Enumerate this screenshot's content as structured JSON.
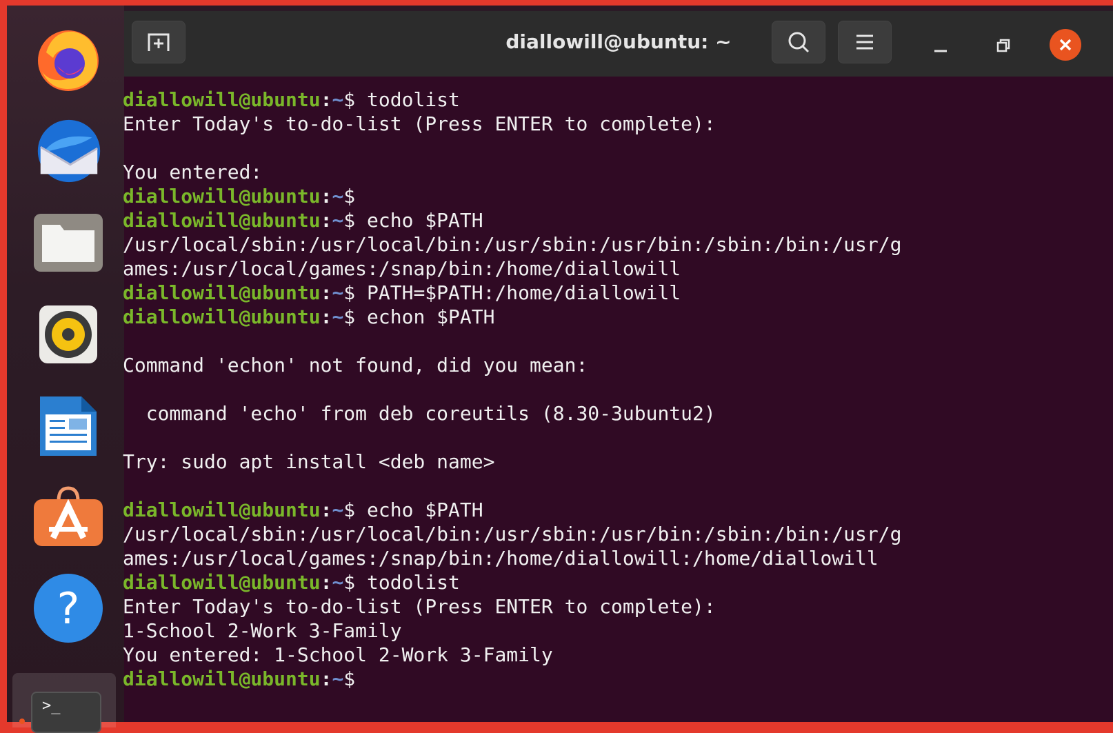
{
  "window": {
    "title": "diallowill@ubuntu: ~"
  },
  "dock": {
    "items": [
      "Firefox",
      "Thunderbird",
      "Files",
      "Rhythmbox",
      "LibreOffice Impress",
      "Ubuntu Software",
      "Help",
      "Terminal"
    ],
    "terminal_glyph": ">_"
  },
  "prompt": {
    "user": "diallowill@ubuntu",
    "sep": ":",
    "path": "~",
    "dollar": "$"
  },
  "terminal": {
    "lines": [
      {
        "type": "prompt",
        "cmd": " todolist"
      },
      {
        "type": "out",
        "text": "Enter Today's to-do-list (Press ENTER to complete):"
      },
      {
        "type": "out",
        "text": ""
      },
      {
        "type": "out",
        "text": "You entered:"
      },
      {
        "type": "prompt",
        "cmd": ""
      },
      {
        "type": "prompt",
        "cmd": " echo $PATH"
      },
      {
        "type": "out",
        "text": "/usr/local/sbin:/usr/local/bin:/usr/sbin:/usr/bin:/sbin:/bin:/usr/g"
      },
      {
        "type": "out",
        "text": "ames:/usr/local/games:/snap/bin:/home/diallowill"
      },
      {
        "type": "prompt",
        "cmd": " PATH=$PATH:/home/diallowill"
      },
      {
        "type": "prompt",
        "cmd": " echon $PATH"
      },
      {
        "type": "out",
        "text": ""
      },
      {
        "type": "out",
        "text": "Command 'echon' not found, did you mean:"
      },
      {
        "type": "out",
        "text": ""
      },
      {
        "type": "out",
        "text": "  command 'echo' from deb coreutils (8.30-3ubuntu2)"
      },
      {
        "type": "out",
        "text": ""
      },
      {
        "type": "out",
        "text": "Try: sudo apt install <deb name>"
      },
      {
        "type": "out",
        "text": ""
      },
      {
        "type": "prompt",
        "cmd": " echo $PATH"
      },
      {
        "type": "out",
        "text": "/usr/local/sbin:/usr/local/bin:/usr/sbin:/usr/bin:/sbin:/bin:/usr/g"
      },
      {
        "type": "out",
        "text": "ames:/usr/local/games:/snap/bin:/home/diallowill:/home/diallowill"
      },
      {
        "type": "prompt",
        "cmd": " todolist"
      },
      {
        "type": "out",
        "text": "Enter Today's to-do-list (Press ENTER to complete):"
      },
      {
        "type": "out",
        "text": "1-School 2-Work 3-Family"
      },
      {
        "type": "out",
        "text": "You entered: 1-School 2-Work 3-Family"
      },
      {
        "type": "prompt",
        "cmd": ""
      }
    ]
  },
  "colors": {
    "terminal_bg": "#300a24",
    "prompt_user": "#7ab72a",
    "prompt_path": "#6f8fcf",
    "accent": "#e95420"
  }
}
